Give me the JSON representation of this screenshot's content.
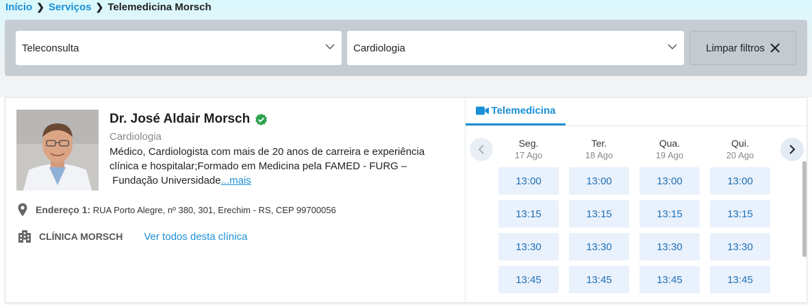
{
  "breadcrumb": {
    "home": "Início",
    "services": "Serviços",
    "current": "Telemedicina Morsch"
  },
  "filters": {
    "consult_type": "Teleconsulta",
    "specialty": "Cardiologia",
    "clear_label": "Limpar filtros"
  },
  "doctor": {
    "name": "Dr. José Aldair Morsch",
    "specialty": "Cardiologia",
    "bio": "Médico, Cardiologista com mais de 20 anos de carreira e experiência clínica e hospitalar;Formado em Medicina pela FAMED - FURG –  Fundação Universidade",
    "more_label": "...mais",
    "address_label": "Endereço 1:",
    "address": "RUA Porto Alegre, nº 380, 301, Erechim - RS, CEP 99700056",
    "clinic_name": "CLÍNICA MORSCH",
    "clinic_link": "Ver todos desta clínica"
  },
  "schedule": {
    "tab_label": "Telemedicina",
    "days": [
      {
        "name": "Seg.",
        "date": "17 Ago",
        "times": [
          "13:00",
          "13:15",
          "13:30",
          "13:45"
        ]
      },
      {
        "name": "Ter.",
        "date": "18 Ago",
        "times": [
          "13:00",
          "13:15",
          "13:30",
          "13:45"
        ]
      },
      {
        "name": "Qua.",
        "date": "19 Ago",
        "times": [
          "13:00",
          "13:15",
          "13:30",
          "13:45"
        ]
      },
      {
        "name": "Qui.",
        "date": "20 Ago",
        "times": [
          "13:00",
          "13:15",
          "13:30",
          "13:45"
        ]
      }
    ]
  },
  "colors": {
    "accent": "#1b8fd6",
    "slot_bg": "#e9f1fc",
    "verified": "#2ea44f"
  }
}
